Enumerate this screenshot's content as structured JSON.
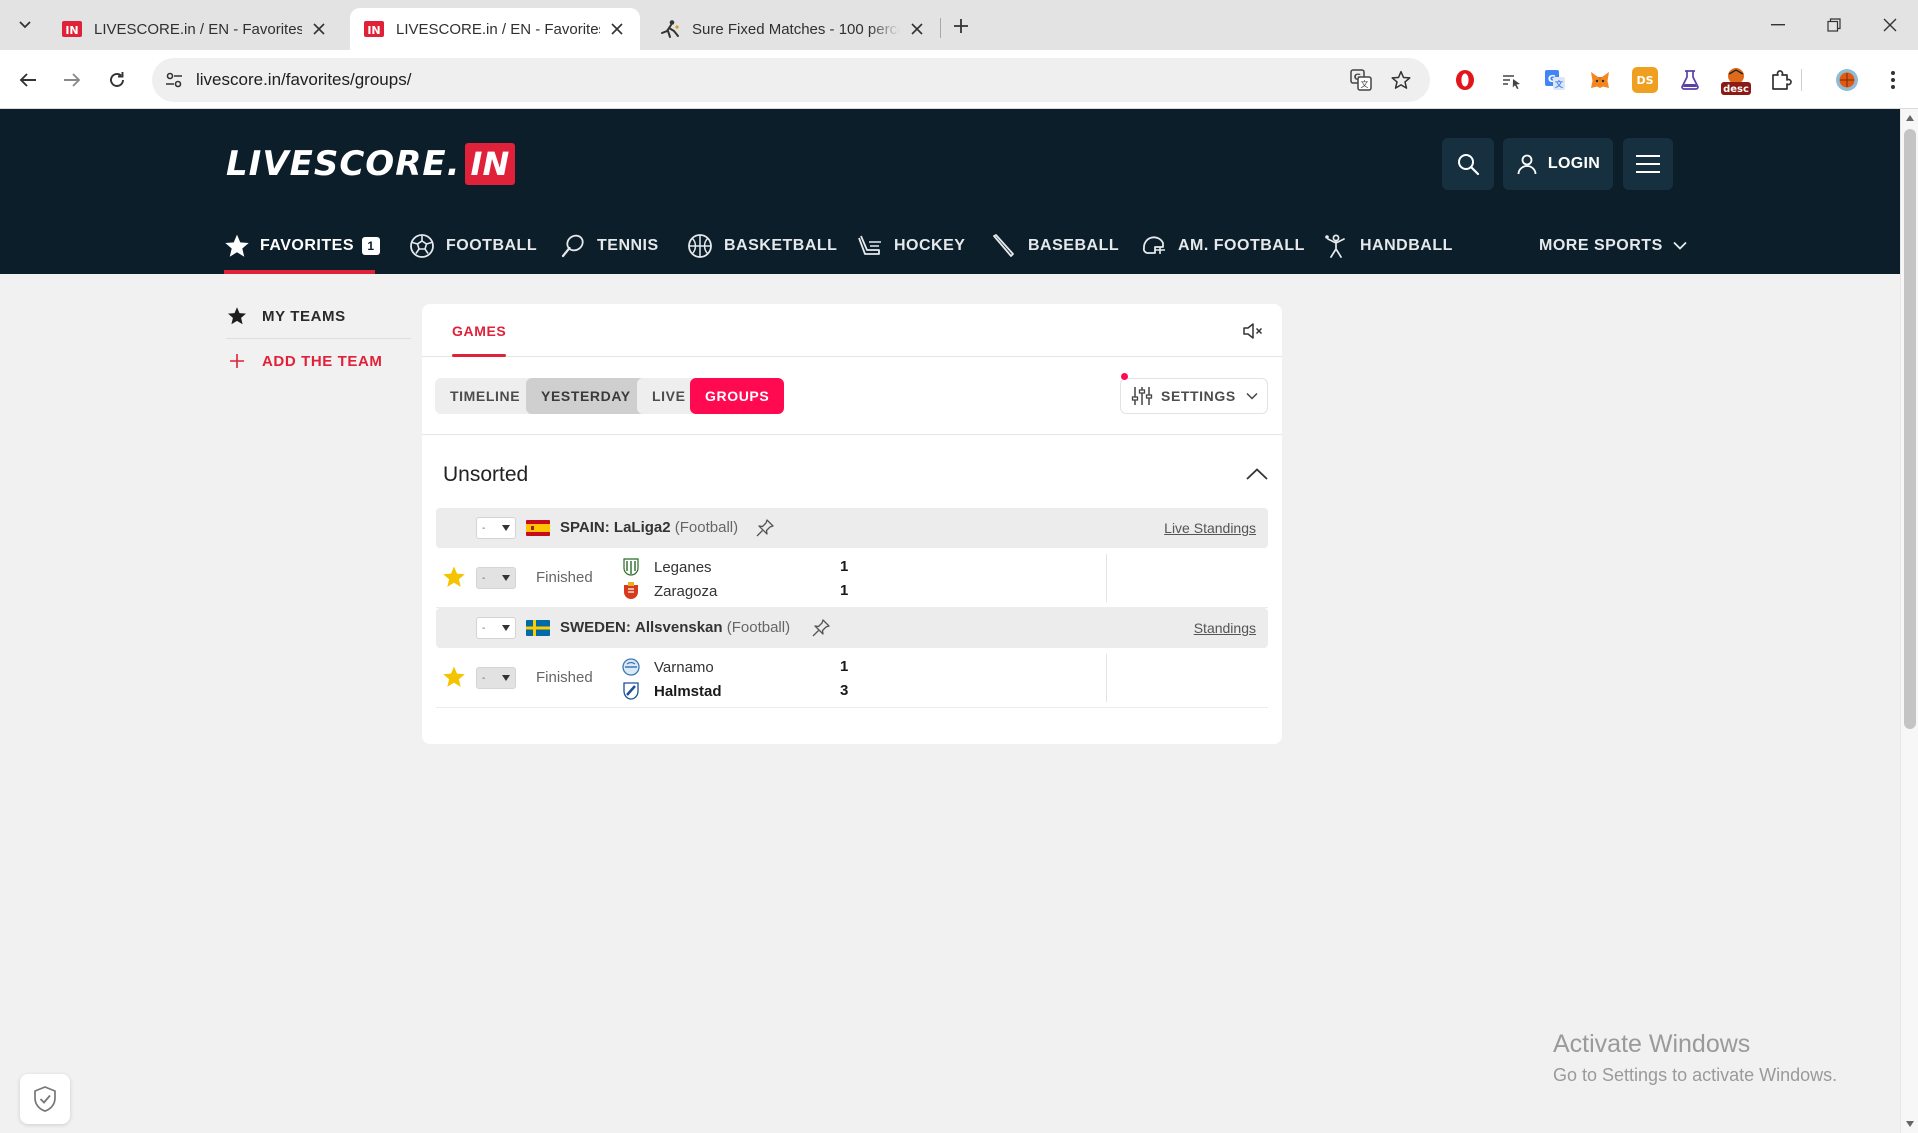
{
  "browser": {
    "tabs": [
      {
        "title": "LIVESCORE.in / EN - Favorites",
        "active": false,
        "favicon": "livescore-in-favicon"
      },
      {
        "title": "LIVESCORE.in / EN - Favorites",
        "active": true,
        "favicon": "livescore-in-favicon"
      },
      {
        "title": "Sure Fixed Matches - 100 perce",
        "active": false,
        "favicon": "player-kick-favicon"
      }
    ],
    "url": "livescore.in/favorites/groups/",
    "extensions": [
      "opera-icon",
      "reader-icon",
      "translate-ext-icon",
      "metamask-fox-icon",
      "ds-icon",
      "lab-icon",
      "desc-icon",
      "puzzle-icon",
      "profile-avatar"
    ]
  },
  "header": {
    "logo_word": "LIVESCORE.",
    "logo_badge": "IN",
    "login_label": "LOGIN",
    "nav": [
      {
        "label": "FAVORITES",
        "icon": "star-icon",
        "count": "1",
        "active": true
      },
      {
        "label": "FOOTBALL",
        "icon": "soccer-ball-icon"
      },
      {
        "label": "TENNIS",
        "icon": "tennis-racket-icon"
      },
      {
        "label": "BASKETBALL",
        "icon": "basketball-icon"
      },
      {
        "label": "HOCKEY",
        "icon": "hockey-icon"
      },
      {
        "label": "BASEBALL",
        "icon": "baseball-bat-icon"
      },
      {
        "label": "AM. FOOTBALL",
        "icon": "football-helmet-icon"
      },
      {
        "label": "HANDBALL",
        "icon": "handball-player-icon"
      }
    ],
    "more_sports": "MORE SPORTS"
  },
  "sidebar": {
    "my_teams": "MY TEAMS",
    "add_team": "ADD THE TEAM"
  },
  "main": {
    "tab": "GAMES",
    "filters": [
      "TIMELINE",
      "YESTERDAY",
      "LIVE",
      "GROUPS"
    ],
    "selected_filter": "YESTERDAY",
    "active_filter": "GROUPS",
    "settings_label": "SETTINGS",
    "group_title": "Unsorted",
    "dropdown_value": "-",
    "leagues": [
      {
        "country": "SPAIN:",
        "name": "LaLiga2",
        "sport": "(Football)",
        "standings": "Live Standings",
        "flag": "spain",
        "match": {
          "status": "Finished",
          "home": {
            "name": "Leganes",
            "score": "1"
          },
          "away": {
            "name": "Zaragoza",
            "score": "1"
          },
          "winner": "none"
        }
      },
      {
        "country": "SWEDEN:",
        "name": "Allsvenskan",
        "sport": "(Football)",
        "standings": "Standings",
        "flag": "sweden",
        "match": {
          "status": "Finished",
          "home": {
            "name": "Varnamo",
            "score": "1"
          },
          "away": {
            "name": "Halmstad",
            "score": "3"
          },
          "winner": "away"
        }
      }
    ]
  },
  "watermark": {
    "line1": "Activate Windows",
    "line2": "Go to Settings to activate Windows."
  },
  "colors": {
    "brand_red": "#e0213a",
    "groups_pink": "#ff0a50",
    "header_bg": "#0b1e2a",
    "star_yellow": "#f5c400"
  }
}
